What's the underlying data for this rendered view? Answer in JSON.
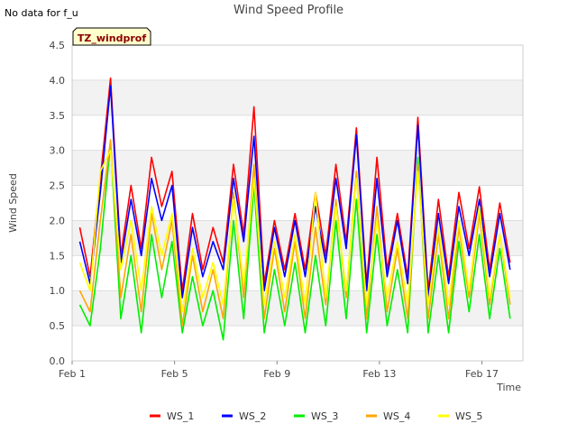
{
  "header": {
    "no_data_note": "No data for f_u",
    "badge_label": "TZ_windprof"
  },
  "chart_data": {
    "type": "line",
    "title": "Wind Speed Profile",
    "xlabel": "Time",
    "ylabel": "Wind Speed",
    "xlim": [
      1,
      18.6
    ],
    "ylim": [
      0,
      4.5
    ],
    "y_ticks": [
      0.0,
      0.5,
      1.0,
      1.5,
      2.0,
      2.5,
      3.0,
      3.5,
      4.0,
      4.5
    ],
    "y_tick_labels": [
      "0.0",
      "0.5",
      "1.0",
      "1.5",
      "2.0",
      "2.5",
      "3.0",
      "3.5",
      "4.0",
      "4.5"
    ],
    "x_ticks": [
      1,
      5,
      9,
      13,
      17
    ],
    "x_tick_labels": [
      "Feb 1",
      "Feb 5",
      "Feb 9",
      "Feb 13",
      "Feb 17"
    ],
    "grid": true,
    "shaded_bands": true,
    "legend_position": "bottom",
    "x": [
      1.3,
      1.7,
      2.1,
      2.5,
      2.9,
      3.3,
      3.7,
      4.1,
      4.5,
      4.9,
      5.3,
      5.7,
      6.1,
      6.5,
      6.9,
      7.3,
      7.7,
      8.1,
      8.5,
      8.9,
      9.3,
      9.7,
      10.1,
      10.5,
      10.9,
      11.3,
      11.7,
      12.1,
      12.5,
      12.9,
      13.3,
      13.7,
      14.1,
      14.5,
      14.9,
      15.3,
      15.7,
      16.1,
      16.5,
      16.9,
      17.3,
      17.7,
      18.1
    ],
    "series": [
      {
        "name": "WS_1",
        "color": "#ff0000",
        "values": [
          1.9,
          1.2,
          2.6,
          4.03,
          1.5,
          2.5,
          1.6,
          2.9,
          2.2,
          2.7,
          1.0,
          2.1,
          1.3,
          1.9,
          1.4,
          2.8,
          1.8,
          3.62,
          1.1,
          2.0,
          1.3,
          2.1,
          1.3,
          2.4,
          1.5,
          2.8,
          1.7,
          3.32,
          1.1,
          2.9,
          1.3,
          2.1,
          1.2,
          3.47,
          1.0,
          2.3,
          1.2,
          2.4,
          1.6,
          2.48,
          1.3,
          2.25,
          1.4
        ]
      },
      {
        "name": "WS_2",
        "color": "#0000ff",
        "values": [
          1.7,
          1.1,
          2.4,
          3.92,
          1.4,
          2.3,
          1.5,
          2.6,
          2.0,
          2.5,
          0.9,
          1.9,
          1.2,
          1.7,
          1.3,
          2.6,
          1.7,
          3.2,
          1.0,
          1.9,
          1.2,
          2.0,
          1.2,
          2.2,
          1.4,
          2.6,
          1.6,
          3.22,
          1.0,
          2.6,
          1.2,
          2.0,
          1.1,
          3.36,
          0.9,
          2.1,
          1.1,
          2.2,
          1.5,
          2.3,
          1.2,
          2.1,
          1.3
        ]
      },
      {
        "name": "WS_3",
        "color": "#00ee00",
        "values": [
          0.8,
          0.5,
          1.6,
          3.1,
          0.6,
          1.5,
          0.4,
          1.8,
          0.9,
          1.7,
          0.4,
          1.2,
          0.5,
          1.0,
          0.3,
          2.0,
          0.6,
          2.5,
          0.4,
          1.3,
          0.5,
          1.4,
          0.4,
          1.5,
          0.5,
          2.0,
          0.6,
          2.3,
          0.4,
          1.8,
          0.5,
          1.3,
          0.4,
          2.9,
          0.4,
          1.5,
          0.4,
          1.7,
          0.7,
          1.8,
          0.6,
          1.6,
          0.6
        ]
      },
      {
        "name": "WS_4",
        "color": "#ffa500",
        "values": [
          1.0,
          0.7,
          2.0,
          3.15,
          0.9,
          1.8,
          0.7,
          2.1,
          1.3,
          2.0,
          0.5,
          1.5,
          0.7,
          1.3,
          0.6,
          2.4,
          0.9,
          2.8,
          0.6,
          1.6,
          0.7,
          1.7,
          0.6,
          1.9,
          0.8,
          2.3,
          0.9,
          2.7,
          0.6,
          2.2,
          0.7,
          1.6,
          0.6,
          2.8,
          0.6,
          1.8,
          0.6,
          1.9,
          0.9,
          2.1,
          0.8,
          1.8,
          0.8
        ]
      },
      {
        "name": "WS_5",
        "color": "#ffff00",
        "values": [
          1.4,
          1.0,
          2.7,
          3.0,
          1.3,
          2.0,
          1.0,
          2.2,
          1.5,
          2.1,
          0.7,
          1.6,
          0.9,
          1.4,
          0.8,
          2.3,
          1.1,
          2.6,
          0.8,
          1.7,
          0.9,
          1.8,
          0.8,
          2.4,
          0.9,
          2.2,
          1.0,
          2.6,
          0.8,
          2.0,
          0.9,
          1.7,
          0.8,
          2.7,
          0.8,
          1.9,
          0.8,
          2.0,
          1.0,
          2.2,
          0.9,
          1.8,
          0.9
        ]
      }
    ]
  }
}
